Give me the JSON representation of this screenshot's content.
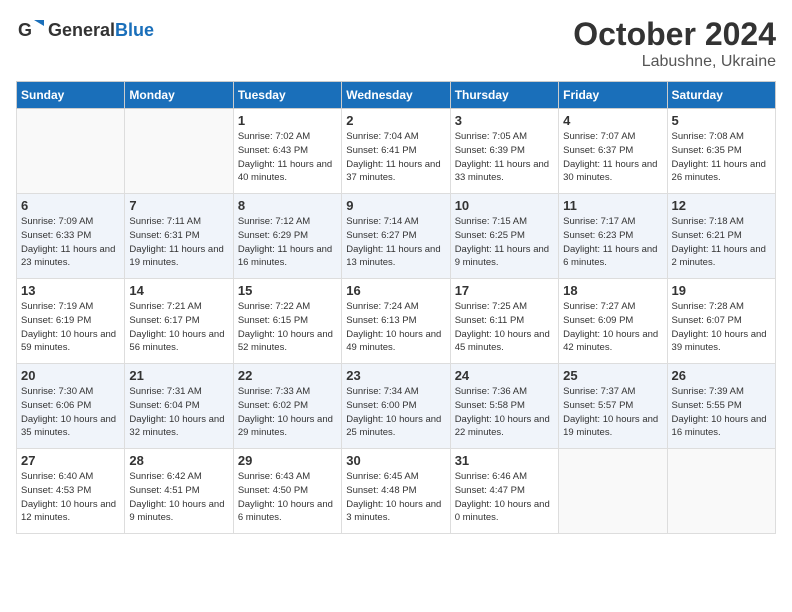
{
  "header": {
    "logo_general": "General",
    "logo_blue": "Blue",
    "month": "October 2024",
    "location": "Labushne, Ukraine"
  },
  "weekdays": [
    "Sunday",
    "Monday",
    "Tuesday",
    "Wednesday",
    "Thursday",
    "Friday",
    "Saturday"
  ],
  "weeks": [
    [
      {
        "day": "",
        "info": ""
      },
      {
        "day": "",
        "info": ""
      },
      {
        "day": "1",
        "info": "Sunrise: 7:02 AM\nSunset: 6:43 PM\nDaylight: 11 hours and 40 minutes."
      },
      {
        "day": "2",
        "info": "Sunrise: 7:04 AM\nSunset: 6:41 PM\nDaylight: 11 hours and 37 minutes."
      },
      {
        "day": "3",
        "info": "Sunrise: 7:05 AM\nSunset: 6:39 PM\nDaylight: 11 hours and 33 minutes."
      },
      {
        "day": "4",
        "info": "Sunrise: 7:07 AM\nSunset: 6:37 PM\nDaylight: 11 hours and 30 minutes."
      },
      {
        "day": "5",
        "info": "Sunrise: 7:08 AM\nSunset: 6:35 PM\nDaylight: 11 hours and 26 minutes."
      }
    ],
    [
      {
        "day": "6",
        "info": "Sunrise: 7:09 AM\nSunset: 6:33 PM\nDaylight: 11 hours and 23 minutes."
      },
      {
        "day": "7",
        "info": "Sunrise: 7:11 AM\nSunset: 6:31 PM\nDaylight: 11 hours and 19 minutes."
      },
      {
        "day": "8",
        "info": "Sunrise: 7:12 AM\nSunset: 6:29 PM\nDaylight: 11 hours and 16 minutes."
      },
      {
        "day": "9",
        "info": "Sunrise: 7:14 AM\nSunset: 6:27 PM\nDaylight: 11 hours and 13 minutes."
      },
      {
        "day": "10",
        "info": "Sunrise: 7:15 AM\nSunset: 6:25 PM\nDaylight: 11 hours and 9 minutes."
      },
      {
        "day": "11",
        "info": "Sunrise: 7:17 AM\nSunset: 6:23 PM\nDaylight: 11 hours and 6 minutes."
      },
      {
        "day": "12",
        "info": "Sunrise: 7:18 AM\nSunset: 6:21 PM\nDaylight: 11 hours and 2 minutes."
      }
    ],
    [
      {
        "day": "13",
        "info": "Sunrise: 7:19 AM\nSunset: 6:19 PM\nDaylight: 10 hours and 59 minutes."
      },
      {
        "day": "14",
        "info": "Sunrise: 7:21 AM\nSunset: 6:17 PM\nDaylight: 10 hours and 56 minutes."
      },
      {
        "day": "15",
        "info": "Sunrise: 7:22 AM\nSunset: 6:15 PM\nDaylight: 10 hours and 52 minutes."
      },
      {
        "day": "16",
        "info": "Sunrise: 7:24 AM\nSunset: 6:13 PM\nDaylight: 10 hours and 49 minutes."
      },
      {
        "day": "17",
        "info": "Sunrise: 7:25 AM\nSunset: 6:11 PM\nDaylight: 10 hours and 45 minutes."
      },
      {
        "day": "18",
        "info": "Sunrise: 7:27 AM\nSunset: 6:09 PM\nDaylight: 10 hours and 42 minutes."
      },
      {
        "day": "19",
        "info": "Sunrise: 7:28 AM\nSunset: 6:07 PM\nDaylight: 10 hours and 39 minutes."
      }
    ],
    [
      {
        "day": "20",
        "info": "Sunrise: 7:30 AM\nSunset: 6:06 PM\nDaylight: 10 hours and 35 minutes."
      },
      {
        "day": "21",
        "info": "Sunrise: 7:31 AM\nSunset: 6:04 PM\nDaylight: 10 hours and 32 minutes."
      },
      {
        "day": "22",
        "info": "Sunrise: 7:33 AM\nSunset: 6:02 PM\nDaylight: 10 hours and 29 minutes."
      },
      {
        "day": "23",
        "info": "Sunrise: 7:34 AM\nSunset: 6:00 PM\nDaylight: 10 hours and 25 minutes."
      },
      {
        "day": "24",
        "info": "Sunrise: 7:36 AM\nSunset: 5:58 PM\nDaylight: 10 hours and 22 minutes."
      },
      {
        "day": "25",
        "info": "Sunrise: 7:37 AM\nSunset: 5:57 PM\nDaylight: 10 hours and 19 minutes."
      },
      {
        "day": "26",
        "info": "Sunrise: 7:39 AM\nSunset: 5:55 PM\nDaylight: 10 hours and 16 minutes."
      }
    ],
    [
      {
        "day": "27",
        "info": "Sunrise: 6:40 AM\nSunset: 4:53 PM\nDaylight: 10 hours and 12 minutes."
      },
      {
        "day": "28",
        "info": "Sunrise: 6:42 AM\nSunset: 4:51 PM\nDaylight: 10 hours and 9 minutes."
      },
      {
        "day": "29",
        "info": "Sunrise: 6:43 AM\nSunset: 4:50 PM\nDaylight: 10 hours and 6 minutes."
      },
      {
        "day": "30",
        "info": "Sunrise: 6:45 AM\nSunset: 4:48 PM\nDaylight: 10 hours and 3 minutes."
      },
      {
        "day": "31",
        "info": "Sunrise: 6:46 AM\nSunset: 4:47 PM\nDaylight: 10 hours and 0 minutes."
      },
      {
        "day": "",
        "info": ""
      },
      {
        "day": "",
        "info": ""
      }
    ]
  ]
}
